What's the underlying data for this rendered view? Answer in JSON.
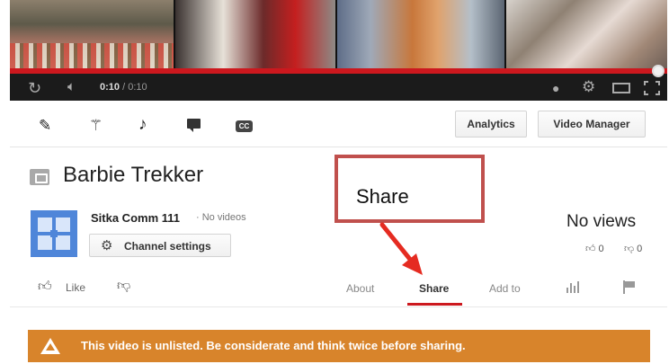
{
  "player": {
    "time_current": "0:10",
    "time_separator": " / ",
    "time_duration": "0:10",
    "progress_fraction": 1.0
  },
  "toolbar": {
    "analytics_label": "Analytics",
    "video_manager_label": "Video Manager",
    "cc_label": "CC"
  },
  "video": {
    "title": "Barbie Trekker",
    "channel_name": "Sitka Comm 111",
    "video_count": "· No videos",
    "channel_settings_label": "Channel settings",
    "views": "No views",
    "like_count": "0",
    "dislike_count": "0"
  },
  "actions": {
    "like_label": "Like",
    "tabs": {
      "about": "About",
      "share": "Share",
      "add_to": "Add to"
    },
    "active_tab": "Share"
  },
  "warning": {
    "text": "This video is unlisted. Be considerate and think twice before sharing.",
    "color": "#d8842b"
  },
  "annotation": {
    "label": "Share",
    "border_color": "#c0504d",
    "arrow_color": "#e52b21"
  },
  "colors": {
    "progress": "#cc181e",
    "avatar": "#4f86d9"
  }
}
